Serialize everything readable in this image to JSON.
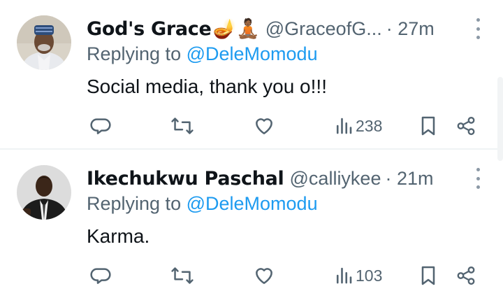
{
  "tweets": [
    {
      "display_name": "God's Grace",
      "emojis": "🪔🧘🏾",
      "handle": "@GraceofG...",
      "time": "· 27m",
      "replying_prefix": "Replying to ",
      "replying_to": "@DeleMomodu",
      "text": "Social media, thank you o!!!",
      "views": "238"
    },
    {
      "display_name": "Ikechukwu Paschal",
      "emojis": "",
      "handle": "@calliykee",
      "time": "· 21m",
      "replying_prefix": "Replying to ",
      "replying_to": "@DeleMomodu",
      "text": "Karma.",
      "views": "103"
    }
  ],
  "icons": {
    "reply": "reply-icon",
    "retweet": "retweet-icon",
    "like": "heart-icon",
    "views": "views-icon",
    "bookmark": "bookmark-icon",
    "share": "share-icon",
    "more": "more-icon"
  },
  "colors": {
    "mention": "#1d9bf0",
    "secondary_text": "#536471",
    "primary_text": "#0f1419"
  }
}
